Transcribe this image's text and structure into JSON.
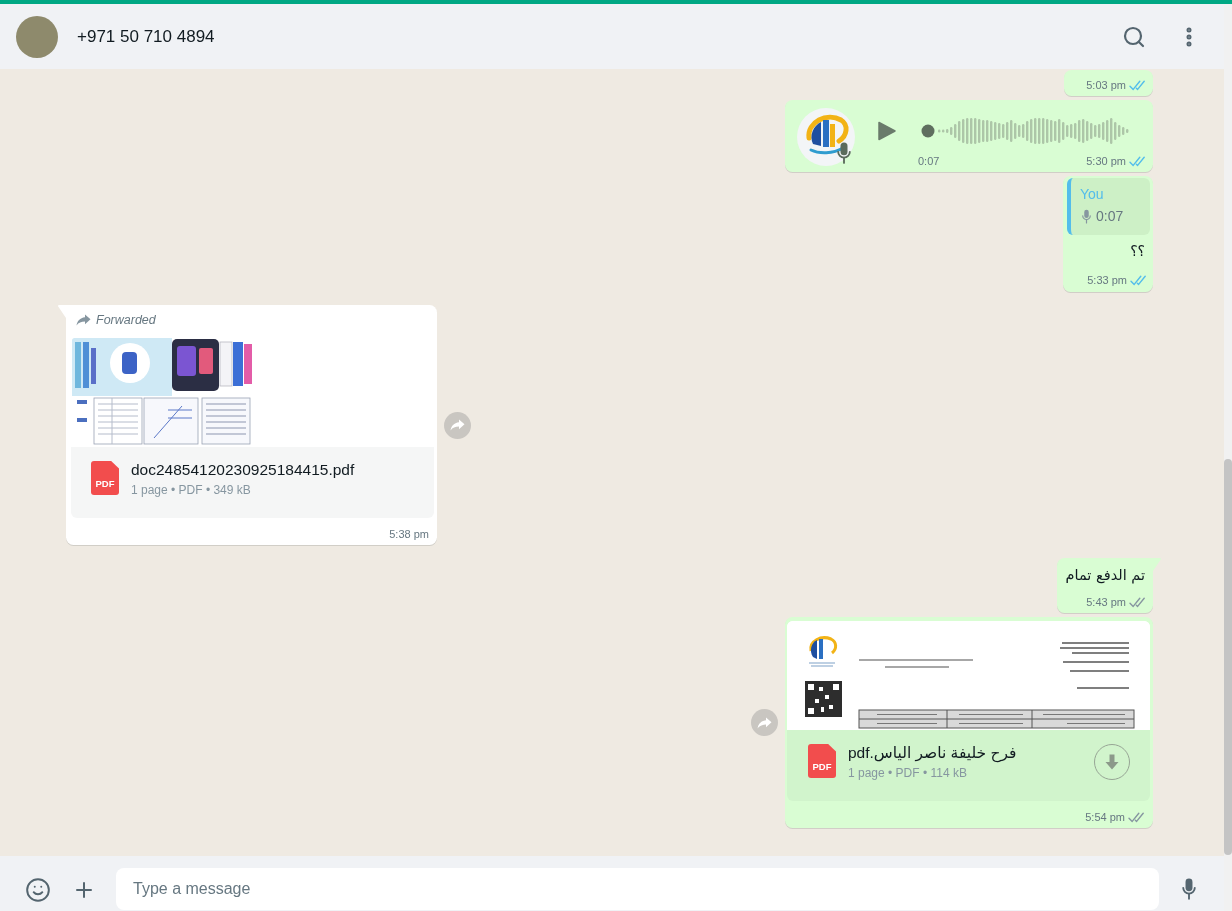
{
  "header": {
    "contact_name": "+971 50 710 4894"
  },
  "messages": [
    {
      "kind": "text",
      "outgoing": true,
      "time": "5:03 pm",
      "read": true
    },
    {
      "kind": "voice",
      "outgoing": true,
      "duration": "0:07",
      "level": 0,
      "time": "5:30 pm",
      "read": true
    },
    {
      "kind": "reply",
      "outgoing": true,
      "quote": {
        "author": "You",
        "duration": "0:07"
      },
      "text": "؟؟",
      "time": "5:33 pm",
      "read": true
    },
    {
      "kind": "document",
      "outgoing": false,
      "forwarded_label": "Forwarded",
      "thumbnail": {
        "kind": "brochure"
      },
      "file_icon": "PDF",
      "file_name": "doc24854120230925184415.pdf",
      "meta": "1 page • PDF • 349 kB",
      "download_button": false,
      "time": "5:38 pm"
    },
    {
      "kind": "text",
      "outgoing": true,
      "text": "تم الدفع تمام",
      "time": "5:43 pm",
      "read": false
    },
    {
      "kind": "document",
      "outgoing": true,
      "thumbnail": {
        "kind": "invoice"
      },
      "file_icon": "PDF",
      "file_name": "فرح خليفة ناصر الياس.pdf",
      "meta": "1 page • PDF • 114 kB",
      "download_button": true,
      "time": "5:54 pm",
      "read": false
    }
  ],
  "composer": {
    "placeholder": "Type a message"
  }
}
